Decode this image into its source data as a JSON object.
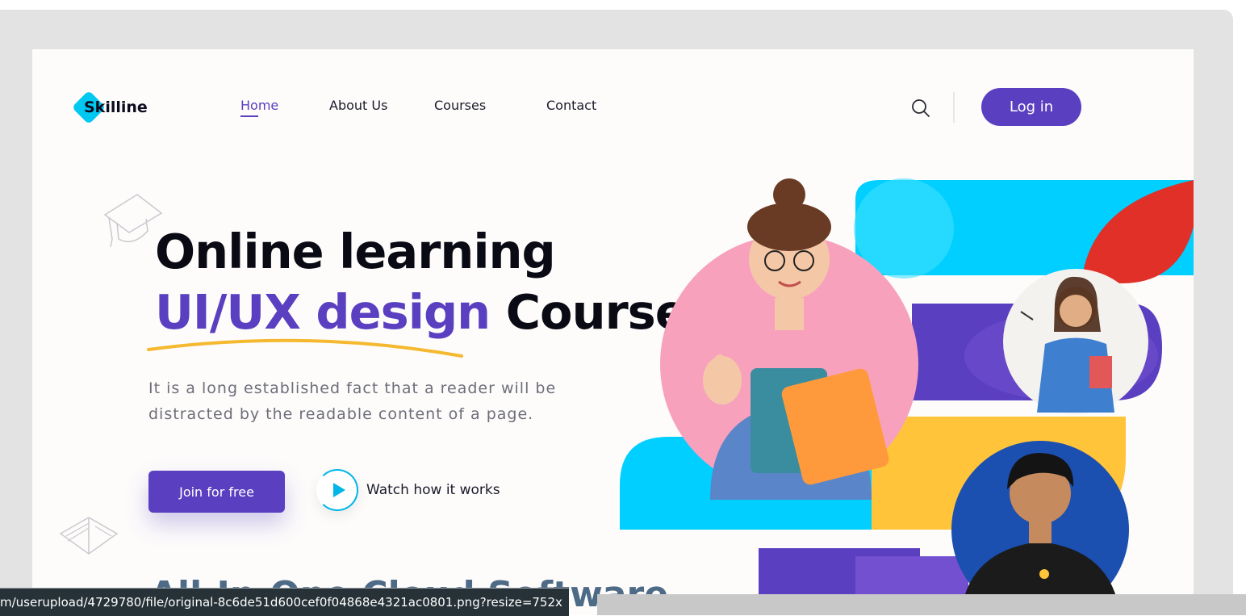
{
  "brand": {
    "name": "Skilline",
    "accent": "#5a3fc0",
    "logo_color": "#00c8f0"
  },
  "nav": {
    "links": [
      "Home",
      "About Us",
      "Courses",
      "Contact"
    ],
    "active": "Home",
    "search_icon": "search-icon",
    "login_label": "Log in"
  },
  "hero": {
    "line1": "Online learning",
    "line2_accent": "UI/UX design",
    "line2_rest": "Course",
    "subtitle": "It is a long established fact that a reader will be distracted by the readable content of a page.",
    "cta_label": "Join for free",
    "watch_label": "Watch how it works",
    "cut_off_heading": "All-In-One Cloud Software"
  },
  "status_url": "m/userupload/4729780/file/original-8c6de51d600cef0f04868e4321ac0801.png?resize=752x"
}
